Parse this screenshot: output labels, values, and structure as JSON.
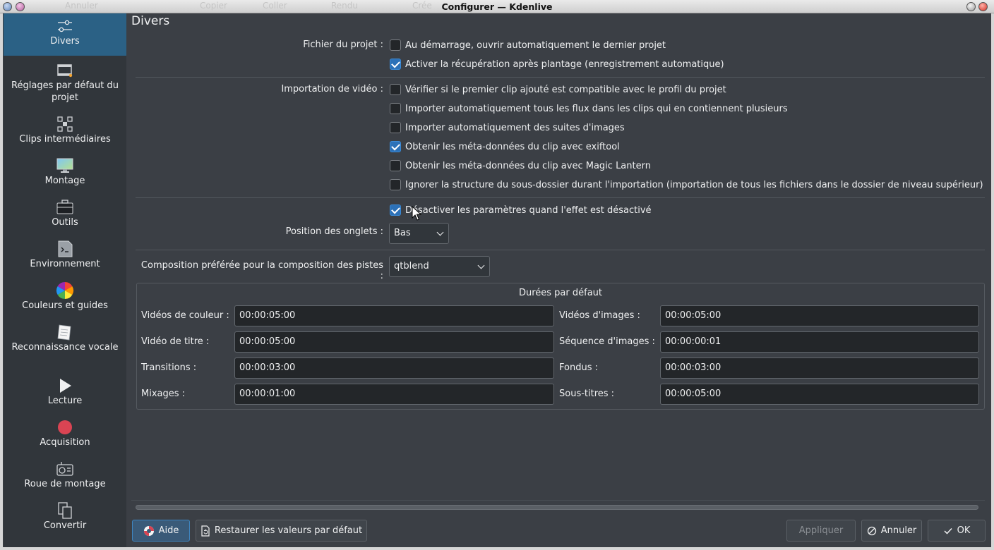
{
  "window": {
    "title": "Configurer — Kdenlive",
    "behind_toolbar": [
      "Annuler",
      "Copier",
      "Coller",
      "Rendu",
      "Crée"
    ]
  },
  "sidebar": {
    "items": [
      {
        "label": "Divers",
        "icon": "sliders-icon",
        "active": true
      },
      {
        "label": "Réglages par défaut du projet",
        "icon": "film-project-icon"
      },
      {
        "label": "Clips intermédiaires",
        "icon": "proxy-clip-icon"
      },
      {
        "label": "Montage",
        "icon": "monitor-icon"
      },
      {
        "label": "Outils",
        "icon": "toolbox-icon"
      },
      {
        "label": "Environnement",
        "icon": "terminal-icon"
      },
      {
        "label": "Couleurs et guides",
        "icon": "color-wheel-icon"
      },
      {
        "label": "Reconnaissance vocale",
        "icon": "notepad-icon"
      },
      {
        "label": "Lecture",
        "icon": "play-icon"
      },
      {
        "label": "Acquisition",
        "icon": "record-icon"
      },
      {
        "label": "Roue de montage",
        "icon": "jogshuttle-icon"
      },
      {
        "label": "Convertir",
        "icon": "copy-convert-icon"
      }
    ]
  },
  "page": {
    "title": "Divers",
    "project_file": {
      "label": "Fichier du projet :",
      "options": [
        {
          "label": "Au démarrage, ouvrir automatiquement le dernier projet",
          "checked": false
        },
        {
          "label": "Activer la récupération après plantage (enregistrement automatique)",
          "checked": true
        }
      ]
    },
    "video_import": {
      "label": "Importation de vidéo :",
      "options": [
        {
          "label": "Vérifier si le premier clip ajouté est compatible avec le profil du projet",
          "checked": false
        },
        {
          "label": "Importer automatiquement tous les flux dans les clips qui en contiennent plusieurs",
          "checked": false
        },
        {
          "label": "Importer automatiquement des suites d'images",
          "checked": false
        },
        {
          "label": "Obtenir les méta-données du clip avec exiftool",
          "checked": true
        },
        {
          "label": "Obtenir les méta-données du clip avec Magic Lantern",
          "checked": false
        },
        {
          "label": "Ignorer la structure du sous-dossier durant l'importation (importation de tous les fichiers dans le dossier de niveau supérieur)",
          "checked": false
        }
      ]
    },
    "disable_params": {
      "label": "Désactiver les paramètres quand l'effet est désactivé",
      "checked": true
    },
    "tab_position": {
      "label": "Position des onglets :",
      "value": "Bas"
    },
    "composition": {
      "label": "Composition préférée pour la composition des pistes :",
      "value": "qtblend"
    },
    "durations": {
      "title": "Durées par défaut",
      "fields": [
        {
          "label": "Vidéos de couleur :",
          "value": "00:00:05:00"
        },
        {
          "label": "Vidéos d'images :",
          "value": "00:00:05:00"
        },
        {
          "label": "Vidéo de titre :",
          "value": "00:00:05:00"
        },
        {
          "label": "Séquence d'images :",
          "value": "00:00:00:01"
        },
        {
          "label": "Transitions :",
          "value": "00:00:03:00"
        },
        {
          "label": "Fondus :",
          "value": "00:00:03:00"
        },
        {
          "label": "Mixages :",
          "value": "00:00:01:00"
        },
        {
          "label": "Sous-titres :",
          "value": "00:00:05:00"
        }
      ]
    }
  },
  "buttons": {
    "help": "Aide",
    "restore": "Restaurer les valeurs par défaut",
    "apply": "Appliquer",
    "cancel": "Annuler",
    "ok": "OK"
  },
  "colors": {
    "accent": "#2b6185",
    "background": "#3b3f45",
    "sidebar": "#31363b",
    "checkbox_checked": "#2c71b8"
  }
}
